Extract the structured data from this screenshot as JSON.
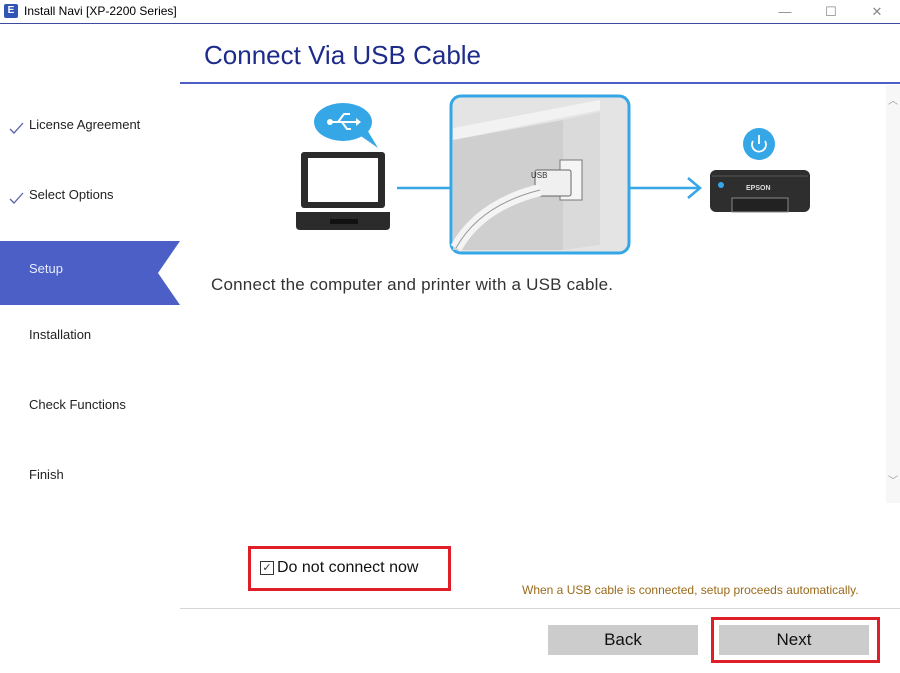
{
  "window": {
    "title": "Install Navi [XP-2200 Series]",
    "app_icon_letter": "E",
    "minimize_glyph": "—",
    "maximize_glyph": "☐",
    "close_glyph": "✕"
  },
  "sidebar": {
    "steps": [
      {
        "label": "License Agreement",
        "state": "completed"
      },
      {
        "label": "Select Options",
        "state": "completed"
      },
      {
        "label": "Setup",
        "state": "active"
      },
      {
        "label": "Installation",
        "state": "pending"
      },
      {
        "label": "Check Functions",
        "state": "pending"
      },
      {
        "label": "Finish",
        "state": "pending"
      }
    ]
  },
  "main": {
    "title": "Connect Via USB Cable",
    "instruction": "Connect the computer and printer with a USB cable.",
    "illustration": {
      "usb_port_label": "USB",
      "printer_brand": "EPSON"
    },
    "do_not_connect": {
      "label": "Do not connect now",
      "checked": true,
      "glyph": "✓"
    },
    "hint": "When a USB cable is connected, setup proceeds automatically."
  },
  "scrollbar": {
    "up_glyph": "︿",
    "down_glyph": "﹀"
  },
  "buttons": {
    "back": "Back",
    "next": "Next"
  },
  "colors": {
    "accent": "#4b5fc7",
    "title": "#1d2b8a",
    "highlight": "#e01e2a",
    "hint": "#9a6a1a",
    "illustration_blue": "#35a6e6"
  }
}
